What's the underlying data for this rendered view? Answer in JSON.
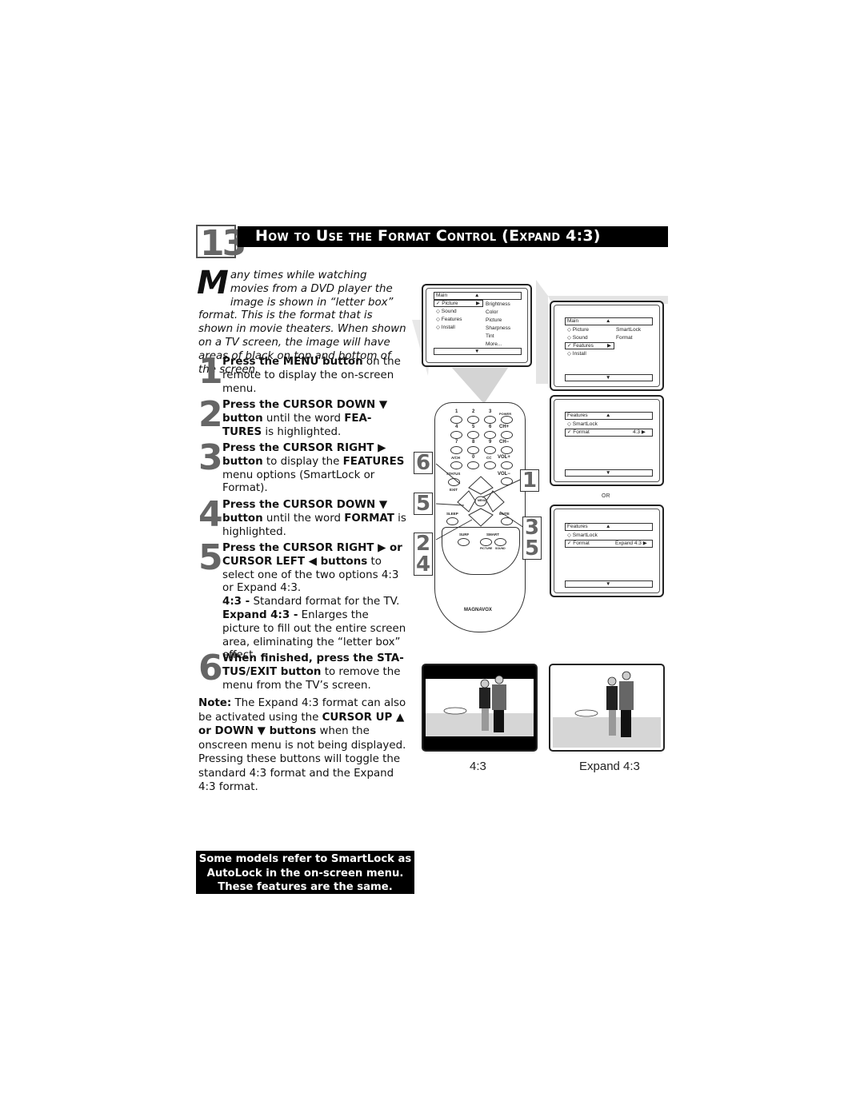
{
  "header": {
    "section_number": "13",
    "title": "How to Use the Format Control (Expand 4:3)"
  },
  "intro": {
    "dropcap": "M",
    "text": "any times while watching movies from a DVD player the image is shown in “letter box” format. This is the format that is shown in movie theaters. When shown on a TV screen, the image will have areas of black on top and bottom of the screen."
  },
  "steps": [
    {
      "number": "1",
      "bold": "Press the MENU button",
      "text": " on the remote to display the on-screen menu."
    },
    {
      "number": "2",
      "bold": "Press the CURSOR DOWN ▼ button",
      "text": " until the word ",
      "bold2": "FEA-TURES",
      "text2": " is highlighted."
    },
    {
      "number": "3",
      "bold": "Press the CURSOR RIGHT ▶ button",
      "text": " to display the ",
      "bold2": "FEATURES",
      "text2": " menu options (SmartLock or Format)."
    },
    {
      "number": "4",
      "bold": "Press the CURSOR DOWN ▼ button",
      "text": " until the word ",
      "bold2": "FORMAT",
      "text2": " is highlighted."
    },
    {
      "number": "5",
      "bold": "Press the CURSOR RIGHT ▶ or CURSOR LEFT ◀ buttons",
      "text": " to select one of the two options 4:3 or Expand 4:3.",
      "def1_term": "4:3 -",
      "def1_text": " Standard format for the TV.",
      "def2_term": "Expand 4:3 -",
      "def2_text": " Enlarges the picture to fill out the entire screen area, eliminating the “letter box” effect."
    },
    {
      "number": "6",
      "bold": "When finished, press the STA-TUS/EXIT button",
      "text": " to remove the menu from the TV’s screen."
    }
  ],
  "note": {
    "label": "Note:",
    "text1": " The Expand 4:3 format can also be activated using the ",
    "bold": "CURSOR UP ▲ or DOWN ▼  buttons",
    "text2": " when the onscreen menu is not being displayed. Pressing these buttons will toggle the standard 4:3 format and the Expand 4:3 format."
  },
  "notice": {
    "line1": "Some models refer to SmartLock as",
    "line2": "AutoLock in the on-screen menu.",
    "line3": "These features are the same."
  },
  "screen_main": {
    "title": "Main",
    "items": [
      "✓ Picture",
      "◇ Sound",
      "◇ Features",
      "◇ Install"
    ],
    "submenu": [
      "Brightness",
      "Color",
      "Picture",
      "Sharpness",
      "Tint",
      "More..."
    ]
  },
  "screen_features_select": {
    "title": "Main",
    "items": [
      "◇ Picture",
      "◇ Sound",
      "✓ Features",
      "◇ Install"
    ],
    "submenu": [
      "SmartLock",
      "Format"
    ]
  },
  "screen_format_43": {
    "title": "Features",
    "items": [
      "◇ SmartLock",
      "✓ Format"
    ],
    "value": "4:3 ▶"
  },
  "or_label": "OR",
  "screen_format_expand": {
    "title": "Features",
    "items": [
      "◇ SmartLock",
      "✓ Format"
    ],
    "value": "Expand 4:3 ▶"
  },
  "remote": {
    "brand": "MAGNAVOX",
    "buttons": [
      "1",
      "2",
      "3",
      "POWER",
      "4",
      "5",
      "6",
      "CH+",
      "7",
      "8",
      "9",
      "CH−",
      "A/CH",
      "0",
      "CC",
      "VOL+",
      "STATUS",
      "VOL−",
      "EXIT",
      "MENU",
      "SLEEP",
      "MUTE",
      "SURF",
      "SMART",
      "PICTURE",
      "SOUND"
    ],
    "callouts": [
      "6",
      "1",
      "5",
      "3",
      "5",
      "2",
      "4"
    ]
  },
  "pictures": {
    "left_caption": "4:3",
    "right_caption": "Expand 4:3"
  },
  "symbols": {
    "up": "▲",
    "down": "▼",
    "right": "▶"
  }
}
